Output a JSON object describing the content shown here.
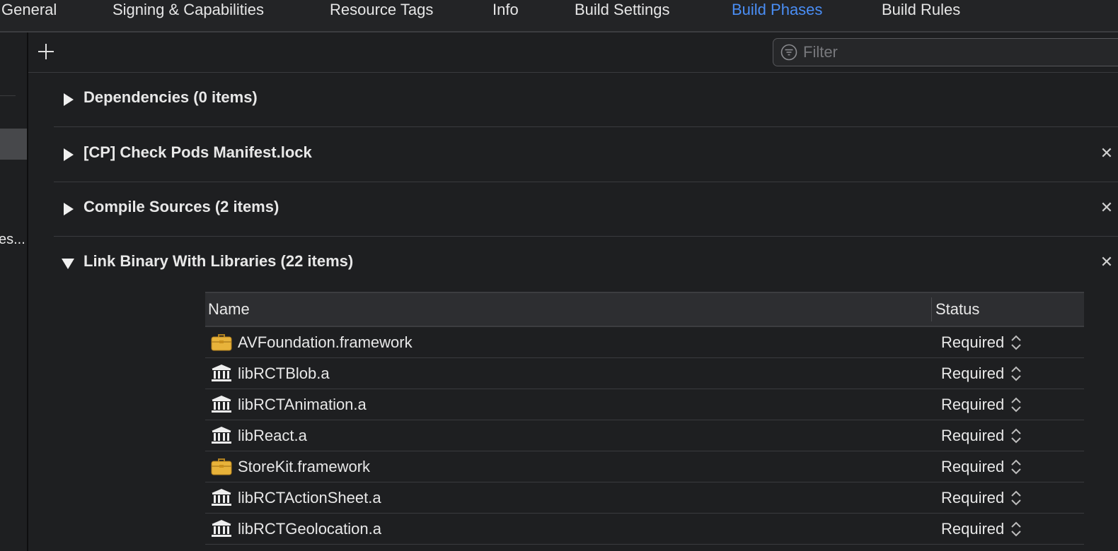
{
  "tabs": [
    {
      "label": "General",
      "active": false
    },
    {
      "label": "Signing & Capabilities",
      "active": false
    },
    {
      "label": "Resource Tags",
      "active": false
    },
    {
      "label": "Info",
      "active": false
    },
    {
      "label": "Build Settings",
      "active": false
    },
    {
      "label": "Build Phases",
      "active": true
    },
    {
      "label": "Build Rules",
      "active": false
    }
  ],
  "sidebar": {
    "truncated_label": "es..."
  },
  "toolbar": {
    "add_icon": "plus-icon",
    "filter": {
      "placeholder": "Filter",
      "value": "",
      "icon": "filter-icon"
    }
  },
  "phases": [
    {
      "title": "Dependencies (0 items)",
      "expanded": false,
      "removable": false
    },
    {
      "title": "[CP] Check Pods Manifest.lock",
      "expanded": false,
      "removable": true
    },
    {
      "title": "Compile Sources (2 items)",
      "expanded": false,
      "removable": true
    },
    {
      "title": "Link Binary With Libraries (22 items)",
      "expanded": true,
      "removable": true
    }
  ],
  "close_glyph": "✕",
  "library_table": {
    "columns": [
      "Name",
      "Status"
    ],
    "rows": [
      {
        "name": "AVFoundation.framework",
        "status": "Required",
        "icon": "framework-toolbox-icon"
      },
      {
        "name": "libRCTBlob.a",
        "status": "Required",
        "icon": "library-building-icon"
      },
      {
        "name": "libRCTAnimation.a",
        "status": "Required",
        "icon": "library-building-icon"
      },
      {
        "name": "libReact.a",
        "status": "Required",
        "icon": "library-building-icon"
      },
      {
        "name": "StoreKit.framework",
        "status": "Required",
        "icon": "framework-toolbox-icon"
      },
      {
        "name": "libRCTActionSheet.a",
        "status": "Required",
        "icon": "library-building-icon"
      },
      {
        "name": "libRCTGeolocation.a",
        "status": "Required",
        "icon": "library-building-icon"
      }
    ]
  },
  "colors": {
    "accent": "#4a8ef5",
    "background": "#1e1f21",
    "header": "#2d2e31",
    "toolbox": "#e8b33a"
  }
}
